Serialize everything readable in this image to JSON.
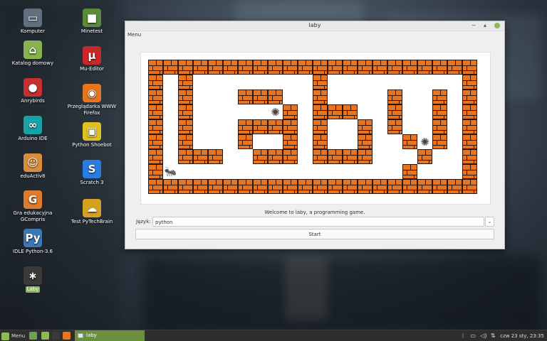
{
  "desktop": {
    "icons": [
      {
        "name": "computer",
        "label": "Komputer",
        "color": "#607080",
        "glyph": "▭"
      },
      {
        "name": "home-folder",
        "label": "Katalog domowy",
        "color": "#86b24f",
        "glyph": "⌂"
      },
      {
        "name": "anrybirds",
        "label": "Anrybirds",
        "color": "#c83030",
        "glyph": "●"
      },
      {
        "name": "arduino-ide",
        "label": "Arduino IDE",
        "color": "#17a2a8",
        "glyph": "∞"
      },
      {
        "name": "eduactiv8",
        "label": "eduActiv8",
        "color": "#d98d3a",
        "glyph": "☺"
      },
      {
        "name": "gcompris",
        "label": "Gra edukacyjna GCompris",
        "color": "#e07b2b",
        "glyph": "G"
      },
      {
        "name": "idle-python",
        "label": "IDLE Python-3.6",
        "color": "#3c78b4",
        "glyph": "Py"
      },
      {
        "name": "laby",
        "label": "Laby",
        "color": "#3a3a3a",
        "glyph": "∗"
      },
      {
        "name": "minetest",
        "label": "Minetest",
        "color": "#5a8a3a",
        "glyph": "■"
      },
      {
        "name": "mu-editor",
        "label": "Mu-Editor",
        "color": "#c82828",
        "glyph": "μ"
      },
      {
        "name": "firefox",
        "label": "Przeglądarka WWW Firefox",
        "color": "#e8741f",
        "glyph": "◉"
      },
      {
        "name": "python-shoebot",
        "label": "Python Shoebot",
        "color": "#e0c020",
        "glyph": "▣"
      },
      {
        "name": "scratch",
        "label": "Scratch 3",
        "color": "#2a7de0",
        "glyph": "S"
      },
      {
        "name": "pytechbrain",
        "label": "Test PyTechBrain",
        "color": "#d4a020",
        "glyph": "☁"
      }
    ]
  },
  "window": {
    "title": "laby",
    "menu": "Menu",
    "minimize": "−",
    "maximize": "▴",
    "welcome": "Welcome to laby, a programming game.",
    "language_label": "Język:",
    "language_value": "python",
    "dropdown_arrow": "⌄",
    "start_label": "Start",
    "web_glyph": "✺",
    "ant_glyph": "🐜"
  },
  "maze": {
    "cols": 22,
    "rows": 9,
    "bricks": [
      [
        0,
        0
      ],
      [
        1,
        0
      ],
      [
        2,
        0
      ],
      [
        3,
        0
      ],
      [
        4,
        0
      ],
      [
        5,
        0
      ],
      [
        6,
        0
      ],
      [
        7,
        0
      ],
      [
        8,
        0
      ],
      [
        9,
        0
      ],
      [
        10,
        0
      ],
      [
        11,
        0
      ],
      [
        12,
        0
      ],
      [
        13,
        0
      ],
      [
        14,
        0
      ],
      [
        15,
        0
      ],
      [
        16,
        0
      ],
      [
        17,
        0
      ],
      [
        18,
        0
      ],
      [
        19,
        0
      ],
      [
        20,
        0
      ],
      [
        21,
        0
      ],
      [
        0,
        1
      ],
      [
        2,
        1
      ],
      [
        11,
        1
      ],
      [
        21,
        1
      ],
      [
        0,
        2
      ],
      [
        2,
        2
      ],
      [
        6,
        2
      ],
      [
        7,
        2
      ],
      [
        8,
        2
      ],
      [
        11,
        2
      ],
      [
        16,
        2
      ],
      [
        19,
        2
      ],
      [
        21,
        2
      ],
      [
        0,
        3
      ],
      [
        2,
        3
      ],
      [
        9,
        3
      ],
      [
        11,
        3
      ],
      [
        12,
        3
      ],
      [
        13,
        3
      ],
      [
        16,
        3
      ],
      [
        19,
        3
      ],
      [
        21,
        3
      ],
      [
        0,
        4
      ],
      [
        2,
        4
      ],
      [
        6,
        4
      ],
      [
        7,
        4
      ],
      [
        8,
        4
      ],
      [
        9,
        4
      ],
      [
        11,
        4
      ],
      [
        14,
        4
      ],
      [
        16,
        4
      ],
      [
        19,
        4
      ],
      [
        21,
        4
      ],
      [
        0,
        5
      ],
      [
        2,
        5
      ],
      [
        6,
        5
      ],
      [
        9,
        5
      ],
      [
        11,
        5
      ],
      [
        14,
        5
      ],
      [
        17,
        5
      ],
      [
        19,
        5
      ],
      [
        21,
        5
      ],
      [
        0,
        6
      ],
      [
        2,
        6
      ],
      [
        3,
        6
      ],
      [
        4,
        6
      ],
      [
        7,
        6
      ],
      [
        8,
        6
      ],
      [
        9,
        6
      ],
      [
        11,
        6
      ],
      [
        12,
        6
      ],
      [
        13,
        6
      ],
      [
        14,
        6
      ],
      [
        18,
        6
      ],
      [
        21,
        6
      ],
      [
        0,
        7
      ],
      [
        17,
        7
      ],
      [
        21,
        7
      ],
      [
        0,
        8
      ],
      [
        1,
        8
      ],
      [
        2,
        8
      ],
      [
        3,
        8
      ],
      [
        4,
        8
      ],
      [
        5,
        8
      ],
      [
        6,
        8
      ],
      [
        7,
        8
      ],
      [
        8,
        8
      ],
      [
        9,
        8
      ],
      [
        10,
        8
      ],
      [
        11,
        8
      ],
      [
        12,
        8
      ],
      [
        13,
        8
      ],
      [
        14,
        8
      ],
      [
        15,
        8
      ],
      [
        16,
        8
      ],
      [
        17,
        8
      ],
      [
        18,
        8
      ],
      [
        19,
        8
      ],
      [
        20,
        8
      ],
      [
        21,
        8
      ]
    ],
    "webs": [
      [
        8,
        3
      ],
      [
        18,
        5
      ]
    ],
    "ant": [
      1,
      7
    ]
  },
  "taskbar": {
    "menu_label": "Menu",
    "task_label": "laby",
    "clock": "czw 23 sty, 23:35",
    "launchers": [
      {
        "name": "show-desktop",
        "color": "#6ea24a"
      },
      {
        "name": "files",
        "color": "#8cbb55"
      },
      {
        "name": "terminal",
        "color": "#3a3a3a"
      },
      {
        "name": "firefox",
        "color": "#e8741f"
      }
    ]
  }
}
